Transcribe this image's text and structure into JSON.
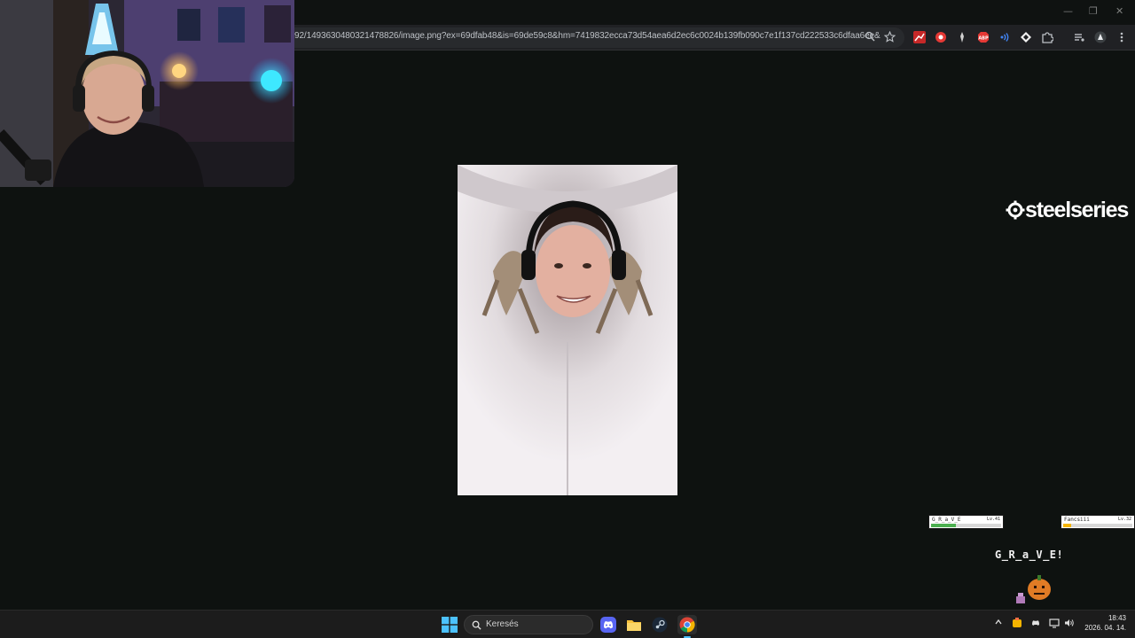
{
  "browser": {
    "url": "92/1493630480321478826/image.png?ex=69dfab48&is=69de59c8&hm=7419832ecca73d54aea6d2ec6c0024b139fb090c7e1f137cd222533c6dfaa6ee&",
    "window_controls": {
      "minimize": "—",
      "restore": "❐",
      "close": "✕"
    },
    "extensions": [
      {
        "name": "red-chart-extension-icon",
        "glyph": "▲",
        "color": "#d93025"
      },
      {
        "name": "red-circle-extension-icon",
        "glyph": "●",
        "color": "#e53935"
      },
      {
        "name": "dark-extension-icon",
        "glyph": "✶",
        "color": "#444444"
      },
      {
        "name": "adblock-extension-icon",
        "glyph": "ABP",
        "color": "#e53935"
      },
      {
        "name": "blue-wave-extension-icon",
        "glyph": "))",
        "color": "#1a73e8"
      },
      {
        "name": "diamond-extension-icon",
        "glyph": "◆",
        "color": "#ffffff"
      },
      {
        "name": "puzzle-extensions-icon",
        "glyph": "⧉",
        "color": "#bdc1c6"
      }
    ]
  },
  "overlay": {
    "brand": "steelseries",
    "players": [
      {
        "name": "G_R_a_V_E",
        "level": "Lv.41",
        "hp_fraction": 0.35,
        "hp_color": "#4caf50"
      },
      {
        "name": "Fancsiii",
        "level": "Lv.32",
        "hp_fraction": 0.12,
        "hp_color": "#f4b400"
      }
    ],
    "shout": "G_R_a_V_E!"
  },
  "taskbar": {
    "search_placeholder": "Keresés",
    "pinned": [
      "windows-start-icon",
      "discord-icon",
      "file-explorer-icon",
      "steam-icon",
      "chrome-icon"
    ],
    "tray": {
      "chevron": "^",
      "wifi": "⌂",
      "volume": "🔊"
    },
    "time": "18:43",
    "date": "2026. 04. 14."
  }
}
